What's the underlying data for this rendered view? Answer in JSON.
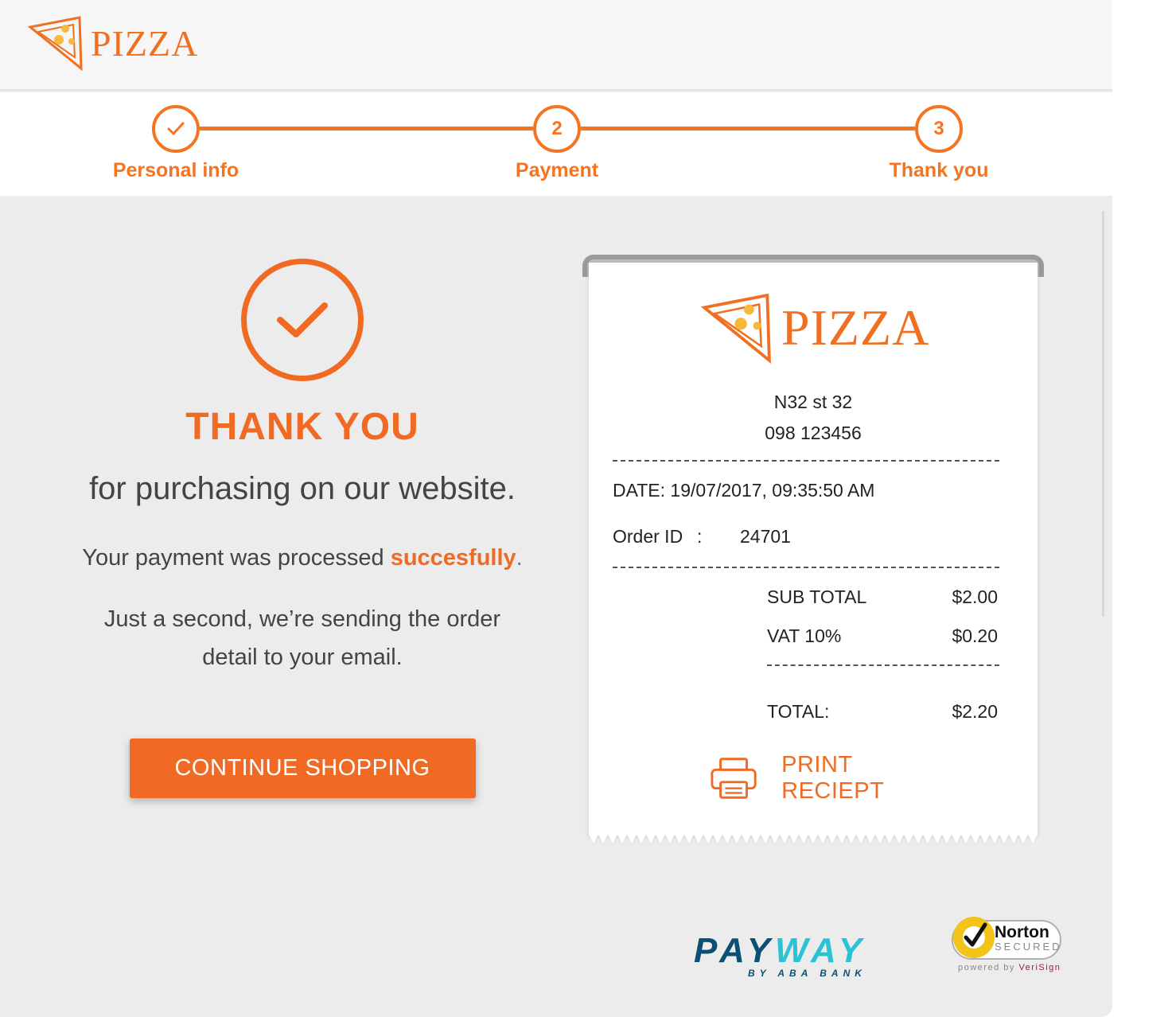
{
  "header": {
    "brand": "PIZZA"
  },
  "steps": [
    {
      "number": "",
      "label": "Personal info",
      "state": "done",
      "icon": "check-icon"
    },
    {
      "number": "2",
      "label": "Payment",
      "state": "active"
    },
    {
      "number": "3",
      "label": "Thank you",
      "state": "active"
    }
  ],
  "confirmation": {
    "icon": "check-circle-icon",
    "title": "THANK YOU",
    "subtitle": "for purchasing on our website.",
    "message_prefix": "Your payment was processed ",
    "message_accent": "succesfully",
    "message_suffix": ".",
    "message_2": "Just a second, we’re sending the order detail to your email.",
    "button_label": "CONTINUE SHOPPING"
  },
  "receipt": {
    "brand": "PIZZA",
    "address": "N32 st 32",
    "phone": "098 123456",
    "date_label": "DATE: 19/07/2017, 09:35:50 AM",
    "order_id_label": "Order ID",
    "order_id_sep": ":",
    "order_id_value": "24701",
    "subtotal_label": "SUB TOTAL",
    "subtotal_value": "$2.00",
    "vat_label": "VAT 10%",
    "vat_value": "$0.20",
    "total_label": "TOTAL:",
    "total_value": "$2.20",
    "print_label": "PRINT RECIEPT",
    "print_icon": "printer-icon"
  },
  "footer": {
    "payway_name_a": "PAY",
    "payway_name_b": "WAY",
    "payway_sub": "BY ABA BANK",
    "norton_name": "Norton",
    "norton_secured": "SECURED",
    "norton_powered": "powered by ",
    "norton_verisign": "VeriSign"
  },
  "colors": {
    "accent": "#f06a23",
    "step": "#f47421",
    "background": "#ececec"
  }
}
